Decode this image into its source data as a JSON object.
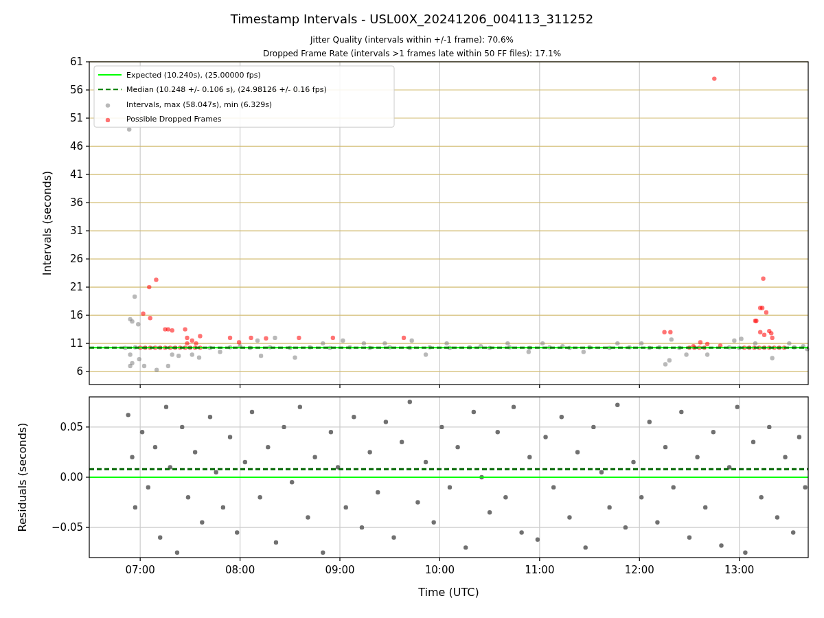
{
  "figure": {
    "title": "Timestamp Intervals - USL00X_20241206_004113_311252",
    "subtitles": [
      "Jitter Quality (intervals within +/-1 frame): 70.6%",
      "Dropped Frame Rate (intervals >1 frames late within 50 FF files): 17.1%"
    ]
  },
  "charts": [
    {
      "chart_data": {
        "type": "scatter",
        "ylabel": "Intervals (seconds)",
        "grid": true,
        "legend": "upper left",
        "xlim": [
          6.49,
          13.69
        ],
        "ylim": [
          3.7,
          61
        ],
        "yticks": [
          {
            "value": 6,
            "label": "6"
          },
          {
            "value": 11,
            "label": "11"
          },
          {
            "value": 16,
            "label": "16"
          },
          {
            "value": 21,
            "label": "21"
          },
          {
            "value": 26,
            "label": "26"
          },
          {
            "value": 31,
            "label": "31"
          },
          {
            "value": 36,
            "label": "36"
          },
          {
            "value": 41,
            "label": "41"
          },
          {
            "value": 46,
            "label": "46"
          },
          {
            "value": 51,
            "label": "51"
          },
          {
            "value": 56,
            "label": "56"
          },
          {
            "value": 61,
            "label": "61"
          }
        ],
        "ref_lines": [
          {
            "axis": "y",
            "value": 10.24,
            "label": "Expected (10.240s), (25.00000 fps)",
            "color": "#00ff00"
          },
          {
            "axis": "y",
            "value": 10.248,
            "label": "Median (10.248 +/- 0.106 s), (24.98126 +/- 0.16 fps)",
            "color": "#008000"
          }
        ],
        "series": [
          {
            "name": "Intervals, max (58.047s), min (6.329s)",
            "color": "#808080",
            "x": [
              6.89,
              6.9,
              6.92,
              6.945,
              6.98,
              6.9,
              6.92,
              6.9,
              6.99,
              7.04,
              7.165,
              7.28,
              7.32,
              7.385,
              7.52,
              7.59,
              7.8,
              8,
              8.175,
              8.35,
              8.21,
              8.55,
              8.83,
              9.03,
              9.24,
              9.45,
              9.72,
              9.86,
              10.07,
              10.41,
              10.68,
              10.89,
              11.03,
              11.23,
              11.44,
              11.78,
              12.02,
              12.26,
              12.3,
              12.32,
              12.47,
              12.68,
              12.95,
              13.02,
              13.16,
              13.33,
              13.5,
              13.64,
              13.68,
              6.85,
              6.95,
              7.7,
              7.9,
              8.1,
              8.3,
              8.5,
              8.7,
              8.9,
              9.1,
              9.3,
              9.5,
              9.7,
              9.9,
              10.1,
              10.3,
              10.5,
              10.7,
              10.9,
              11.1,
              11.3,
              11.5,
              11.7,
              11.9,
              12.1,
              12.2,
              12.4,
              12.9,
              13.0,
              13.55
            ],
            "values": [
              49,
              15.3,
              14.9,
              19.3,
              14.4,
              9,
              7.5,
              7,
              8.2,
              7,
              6.3,
              7,
              9,
              8.8,
              9,
              8.5,
              9.5,
              10.5,
              11.5,
              12,
              8.8,
              8.5,
              11,
              11.5,
              11,
              11,
              11.5,
              9,
              11,
              10.5,
              11,
              9.5,
              11,
              10.5,
              9.5,
              11,
              11,
              7.3,
              8,
              11.7,
              9,
              9,
              11.5,
              11.8,
              11,
              8.4,
              11,
              10.5,
              10,
              10.2,
              10.3,
              10.2,
              10.3,
              10.2,
              10.3,
              10.2,
              10.3,
              10.2,
              10.3,
              10.2,
              10.3,
              10.2,
              10.3,
              10.2,
              10.3,
              10.2,
              10.3,
              10.2,
              10.3,
              10.2,
              10.3,
              10.2,
              10.3,
              10.2,
              10.3,
              10.2,
              10.3,
              10.2,
              10.3
            ]
          },
          {
            "name": "Possible Dropped Frames",
            "color": "#ff0000",
            "x": [
              7.03,
              7.09,
              7.1,
              7.16,
              7.25,
              7.28,
              7.32,
              7.45,
              7.47,
              7.47,
              7.52,
              7.56,
              7.6,
              7.99,
              7.9,
              8.11,
              8.26,
              8.59,
              8.93,
              9.64,
              12.25,
              12.31,
              13.16,
              13.17,
              13.21,
              13.23,
              13.24,
              13.25,
              13.27,
              13.3,
              13.32,
              13.33,
              13.21,
              12.75,
              12.68,
              12.61,
              12.54,
              12.81,
              7.0,
              7.05,
              7.1,
              7.15,
              7.2,
              7.25,
              7.3,
              7.35,
              7.4,
              7.45,
              7.5,
              7.55,
              7.6,
              12.5,
              12.55,
              12.6,
              12.65,
              13.05,
              13.1,
              13.15,
              13.2,
              13.25,
              13.3,
              13.35,
              13.4,
              13.45
            ],
            "values": [
              16.3,
              21,
              15.5,
              22.3,
              13.5,
              13.5,
              13.3,
              13.5,
              12,
              11,
              11.5,
              11,
              12.3,
              11.2,
              12,
              12,
              11.9,
              12,
              12,
              12,
              13,
              13,
              15,
              15,
              17.3,
              17.3,
              22.5,
              12.5,
              16.5,
              13.2,
              12.8,
              12,
              13,
              58,
              10.9,
              11.2,
              10.5,
              10.6,
              10.24,
              10.24,
              10.24,
              10.24,
              10.24,
              10.24,
              10.24,
              10.24,
              10.24,
              10.24,
              10.24,
              10.24,
              10.24,
              10.24,
              10.24,
              10.24,
              10.24,
              10.24,
              10.24,
              10.24,
              10.24,
              10.24,
              10.24,
              10.24,
              10.24,
              10.24
            ]
          }
        ]
      }
    },
    {
      "chart_data": {
        "type": "scatter",
        "xlabel": "Time (UTC)",
        "ylabel": "Residuals (seconds)",
        "grid": true,
        "xlim": [
          6.49,
          13.69
        ],
        "ylim": [
          -0.08,
          0.08
        ],
        "xticks": [
          {
            "value": 7,
            "label": "07:00"
          },
          {
            "value": 8,
            "label": "08:00"
          },
          {
            "value": 9,
            "label": "09:00"
          },
          {
            "value": 10,
            "label": "10:00"
          },
          {
            "value": 11,
            "label": "11:00"
          },
          {
            "value": 12,
            "label": "12:00"
          },
          {
            "value": 13,
            "label": "13:00"
          }
        ],
        "yticks": [
          {
            "value": 0.05,
            "label": "0.05"
          },
          {
            "value": 0,
            "label": "0.00"
          },
          {
            "value": -0.05,
            "label": "−0.05"
          }
        ],
        "ref_lines": [
          {
            "axis": "y",
            "value": 0,
            "color": "#00ff00"
          },
          {
            "axis": "y",
            "value": 0.008,
            "color": "#006400"
          }
        ],
        "series": [
          {
            "color": "#707070",
            "x": [
              6.88,
              6.92,
              6.95,
              7.02,
              7.08,
              7.15,
              7.2,
              7.26,
              7.3,
              7.37,
              7.42,
              7.48,
              7.55,
              7.62,
              7.7,
              7.76,
              7.83,
              7.9,
              7.97,
              8.05,
              8.12,
              8.2,
              8.28,
              8.36,
              8.44,
              8.52,
              8.6,
              8.68,
              8.75,
              8.83,
              8.91,
              8.98,
              9.06,
              9.14,
              9.22,
              9.3,
              9.38,
              9.46,
              9.54,
              9.62,
              9.7,
              9.78,
              9.86,
              9.94,
              10.02,
              10.1,
              10.18,
              10.26,
              10.34,
              10.42,
              10.5,
              10.58,
              10.66,
              10.74,
              10.82,
              10.9,
              10.98,
              11.06,
              11.14,
              11.22,
              11.3,
              11.38,
              11.46,
              11.54,
              11.62,
              11.7,
              11.78,
              11.86,
              11.94,
              12.02,
              12.1,
              12.18,
              12.26,
              12.34,
              12.42,
              12.5,
              12.58,
              12.66,
              12.74,
              12.82,
              12.9,
              12.98,
              13.06,
              13.14,
              13.22,
              13.3,
              13.38,
              13.46,
              13.54,
              13.6,
              13.66
            ],
            "values": [
              0.062,
              0.02,
              -0.03,
              0.045,
              -0.01,
              0.03,
              -0.06,
              0.07,
              0.01,
              -0.075,
              0.05,
              -0.02,
              0.025,
              -0.045,
              0.06,
              0.005,
              -0.03,
              0.04,
              -0.055,
              0.015,
              0.065,
              -0.02,
              0.03,
              -0.065,
              0.05,
              -0.005,
              0.07,
              -0.04,
              0.02,
              -0.075,
              0.045,
              0.01,
              -0.03,
              0.06,
              -0.05,
              0.025,
              -0.015,
              0.055,
              -0.06,
              0.035,
              0.075,
              -0.025,
              0.015,
              -0.045,
              0.05,
              -0.01,
              0.03,
              -0.07,
              0.065,
              0.0,
              -0.035,
              0.045,
              -0.02,
              0.07,
              -0.055,
              0.02,
              -0.062,
              0.04,
              -0.01,
              0.06,
              -0.04,
              0.025,
              -0.07,
              0.05,
              0.005,
              -0.03,
              0.072,
              -0.05,
              0.015,
              -0.02,
              0.055,
              -0.045,
              0.03,
              -0.01,
              0.065,
              -0.06,
              0.02,
              -0.03,
              0.045,
              -0.068,
              0.01,
              0.07,
              -0.075,
              0.035,
              -0.02,
              0.05,
              -0.04,
              0.02,
              -0.055,
              0.04,
              -0.01
            ]
          }
        ]
      }
    }
  ]
}
